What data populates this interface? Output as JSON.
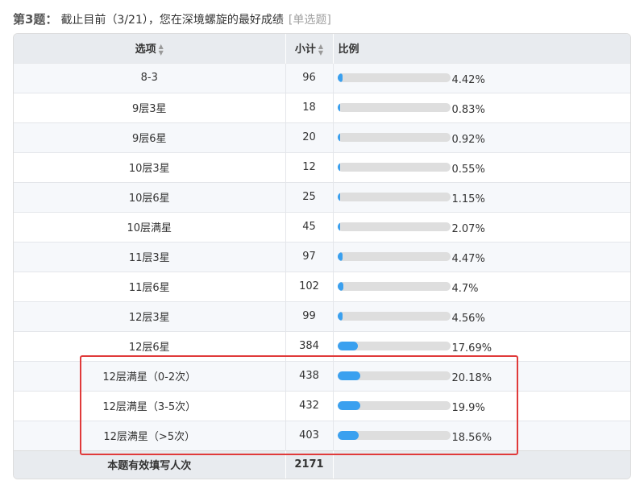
{
  "question": {
    "number_label": "第3题：",
    "text": "截止目前（3/21），您在深境螺旋的最好成绩",
    "type_label": "[单选题]"
  },
  "table": {
    "headers": {
      "option": "选项",
      "count": "小计",
      "percent": "比例",
      "sort_icon": "sort-icon"
    },
    "rows": [
      {
        "option": "8-3",
        "count": "96",
        "percent": "4.42%",
        "fraction": 0.0442
      },
      {
        "option": "9层3星",
        "count": "18",
        "percent": "0.83%",
        "fraction": 0.0083
      },
      {
        "option": "9层6星",
        "count": "20",
        "percent": "0.92%",
        "fraction": 0.0092
      },
      {
        "option": "10层3星",
        "count": "12",
        "percent": "0.55%",
        "fraction": 0.0055
      },
      {
        "option": "10层6星",
        "count": "25",
        "percent": "1.15%",
        "fraction": 0.0115
      },
      {
        "option": "10层满星",
        "count": "45",
        "percent": "2.07%",
        "fraction": 0.0207
      },
      {
        "option": "11层3星",
        "count": "97",
        "percent": "4.47%",
        "fraction": 0.0447
      },
      {
        "option": "11层6星",
        "count": "102",
        "percent": "4.7%",
        "fraction": 0.047
      },
      {
        "option": "12层3星",
        "count": "99",
        "percent": "4.56%",
        "fraction": 0.0456
      },
      {
        "option": "12层6星",
        "count": "384",
        "percent": "17.69%",
        "fraction": 0.1769
      },
      {
        "option": "12层满星（0-2次）",
        "count": "438",
        "percent": "20.18%",
        "fraction": 0.2018
      },
      {
        "option": "12层满星（3-5次）",
        "count": "432",
        "percent": "19.9%",
        "fraction": 0.199
      },
      {
        "option": "12层满星（>5次）",
        "count": "403",
        "percent": "18.56%",
        "fraction": 0.1856
      }
    ],
    "footer": {
      "label": "本题有效填写人次",
      "total": "2171"
    }
  },
  "colors": {
    "bar_fill": "#3aa0ef",
    "bar_track": "#dedede",
    "highlight_border": "#e03a3a",
    "header_bg": "#e8ebef"
  }
}
